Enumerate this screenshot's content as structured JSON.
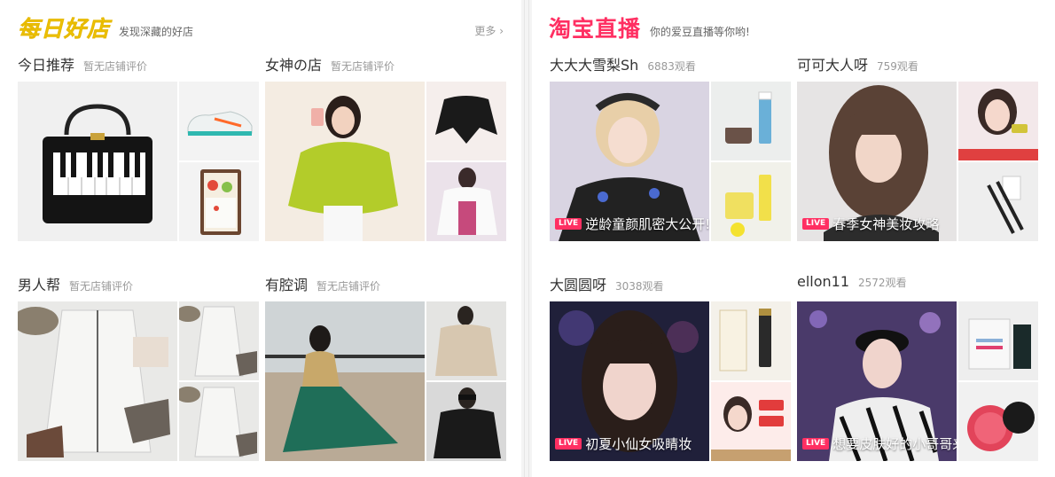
{
  "left": {
    "logo": "每日好店",
    "slogan": "发现深藏的好店",
    "more": "更多 ›",
    "shops": [
      {
        "name": "今日推荐",
        "sub": "暂无店铺评价"
      },
      {
        "name": "女神の店",
        "sub": "暂无店铺评价"
      },
      {
        "name": "男人帮",
        "sub": "暂无店铺评价"
      },
      {
        "name": "有腔调",
        "sub": "暂无店铺评价"
      }
    ]
  },
  "right": {
    "logo": "淘宝直播",
    "slogan": "你的爱豆直播等你哟!",
    "streams": [
      {
        "name": "大大大雪梨Sh",
        "views": "6883观看",
        "badge": "LIVE",
        "caption": "逆龄童颜肌密大公开!"
      },
      {
        "name": "可可大人呀",
        "views": "759观看",
        "badge": "LIVE",
        "caption": "春季女神美妆攻略"
      },
      {
        "name": "大圆圆呀",
        "views": "3038观看",
        "badge": "LIVE",
        "caption": "初夏小仙女吸睛妆"
      },
      {
        "name": "ellon11",
        "views": "2572观看",
        "badge": "LIVE",
        "caption": "想要皮肤好的小哥哥来"
      }
    ]
  },
  "colors": {
    "accent_red": "#ff2f62",
    "accent_yellow": "#f6d000"
  }
}
